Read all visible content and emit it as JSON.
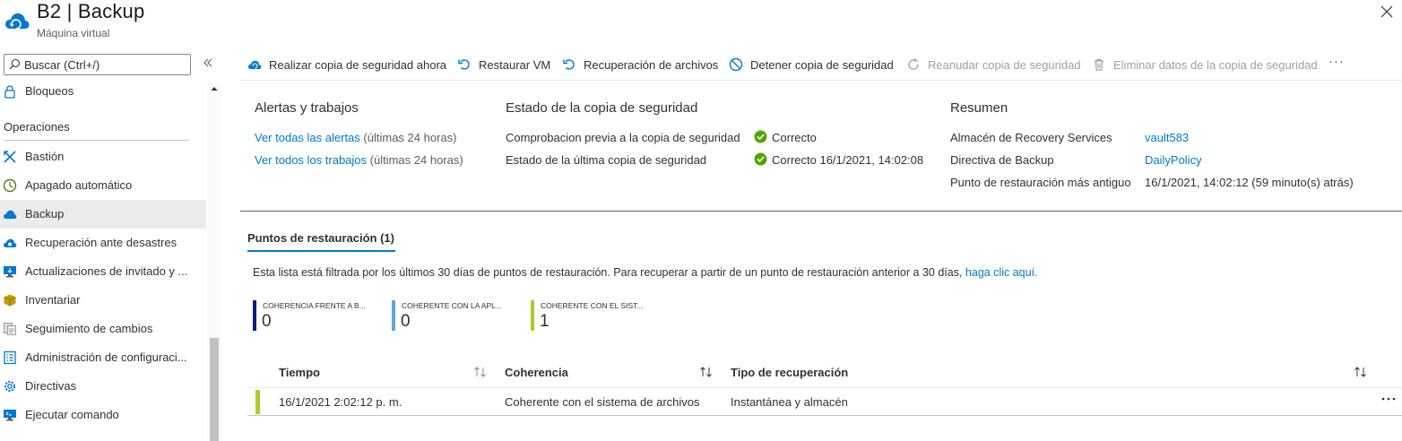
{
  "header": {
    "title": "B2 | Backup",
    "subtitle": "Máquina virtual"
  },
  "sidebar": {
    "search_placeholder": "Buscar (Ctrl+/)",
    "top_item": {
      "label": "Bloqueos",
      "icon": "lock-icon"
    },
    "section": "Operaciones",
    "items": [
      {
        "label": "Bastión",
        "icon": "bastion-icon"
      },
      {
        "label": "Apagado automático",
        "icon": "clock-icon"
      },
      {
        "label": "Backup",
        "icon": "backup-cloud-icon",
        "active": true
      },
      {
        "label": "Recuperación ante desastres",
        "icon": "site-recovery-icon"
      },
      {
        "label": "Actualizaciones de invitado y ...",
        "icon": "monitor-update-icon"
      },
      {
        "label": "Inventariar",
        "icon": "box-icon"
      },
      {
        "label": "Seguimiento de cambios",
        "icon": "change-tracking-icon"
      },
      {
        "label": "Administración de configuraci...",
        "icon": "config-list-icon"
      },
      {
        "label": "Directivas",
        "icon": "policy-gear-icon"
      },
      {
        "label": "Ejecutar comando",
        "icon": "run-command-icon"
      }
    ]
  },
  "toolbar": {
    "backup_now": "Realizar copia de seguridad ahora",
    "restore_vm": "Restaurar VM",
    "file_recovery": "Recuperación de archivos",
    "stop_backup": "Detener copia de seguridad",
    "resume_backup": "Reanudar copia de seguridad",
    "delete_backup_data": "Eliminar datos de la copia de seguridad",
    "more": "···"
  },
  "alerts": {
    "title": "Alertas y trabajos",
    "alerts_link": "Ver todas las alertas",
    "alerts_suffix": "(últimas 24 horas)",
    "jobs_link": "Ver todos los trabajos",
    "jobs_suffix": "(últimas 24 horas)"
  },
  "backup_status": {
    "title": "Estado de la copia de seguridad",
    "precheck_label": "Comprobacion previa a la copia de seguridad",
    "precheck_value": "Correcto",
    "last_backup_label": "Estado de la última copia de seguridad",
    "last_backup_value": "Correcto 16/1/2021, 14:02:08",
    "status_color": "#57a300"
  },
  "summary": {
    "title": "Resumen",
    "vault_label": "Almacén de Recovery Services",
    "vault_value": "vault583",
    "policy_label": "Directiva de Backup",
    "policy_value": "DailyPolicy",
    "oldest_label": "Punto de restauración más antiguo",
    "oldest_value": "16/1/2021, 14:02:12 (59 minuto(s) atrás)"
  },
  "restore_points": {
    "tab_label": "Puntos de restauración (1)",
    "info_text": "Esta lista está filtrada por los últimos 30 días de puntos de restauración. Para recuperar a partir de un punto de restauración anterior a 30 días,",
    "info_link": "haga clic aquí.",
    "tiles": [
      {
        "label": "COHERENCIA FRENTE A B...",
        "value": "0",
        "color": "#001e80"
      },
      {
        "label": "COHERENTE CON LA APL...",
        "value": "0",
        "color": "#5ea7d6"
      },
      {
        "label": "COHERENTE CON EL SIST...",
        "value": "1",
        "color": "#b4c82e"
      }
    ],
    "columns": [
      "Tiempo",
      "Coherencia",
      "Tipo de recuperación"
    ],
    "rows": [
      {
        "time": "16/1/2021 2:02:12 p. m.",
        "consistency": "Coherente con el sistema de archivos",
        "recovery_type": "Instantánea y almacén"
      }
    ]
  }
}
